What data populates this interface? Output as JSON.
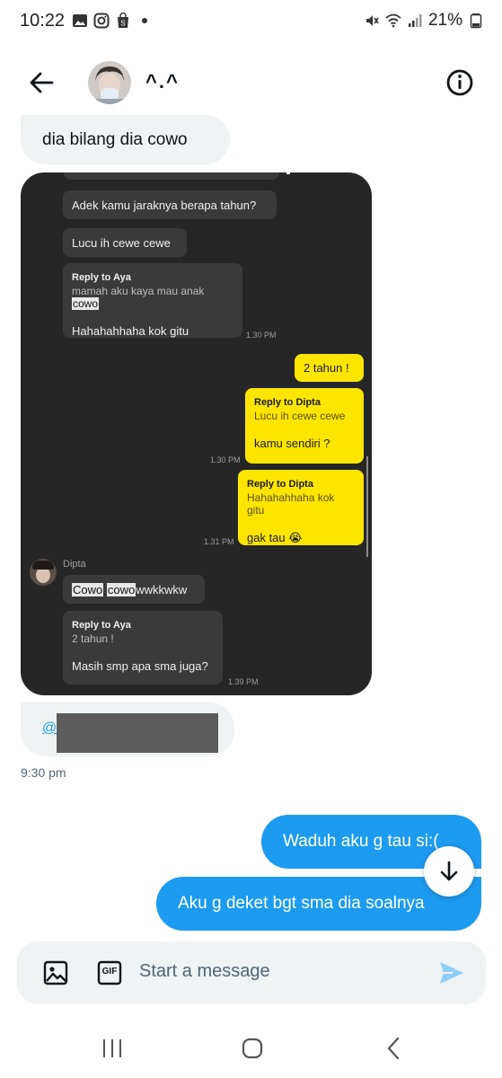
{
  "status_bar": {
    "time": "10:22",
    "battery": "21%",
    "left_icons": [
      "image-icon",
      "instagram-icon",
      "shop-icon",
      "dot-icon"
    ],
    "right_icons": [
      "mute-icon",
      "wifi-icon",
      "signal-icon",
      "battery-icon"
    ]
  },
  "header": {
    "title": "^.^",
    "back_icon": "arrow-left-icon",
    "info_icon": "info-icon"
  },
  "messages": {
    "in_1": "dia bilang dia cowo",
    "mention_prefix": "@",
    "timestamp_1": "9:30 pm",
    "out_1": "Waduh aku g tau si:(",
    "out_2": "Aku g deket bgt sma dia soalnya"
  },
  "screenshot": {
    "m1": "Adek kamu jaraknya berapa tahun?",
    "m2": "Lucu ih cewe cewe",
    "m3_reply_title": "Reply to Aya",
    "m3_quote_prefix": "mamah aku kaya mau anak ",
    "m3_quote_highlight": "cowo",
    "m3_text": "Hahahahhaha kok gitu",
    "m3_time": "1.30 PM",
    "o1": "2 tahun !",
    "o2_reply_title": "Reply to Dipta",
    "o2_quote": "Lucu ih cewe cewe",
    "o2_text": "kamu sendiri ?",
    "o2_time": "1.30 PM",
    "o3_reply_title": "Reply to Dipta",
    "o3_quote": "Hahahahhaha kok gitu",
    "o3_text": "gak tau 😭",
    "o3_time": "1.31 PM",
    "sender_name": "Dipta",
    "m4_hl1": "Cowo",
    "m4_hl2": "cowo",
    "m4_rest": " wwkkwkw",
    "m5_reply_title": "Reply to Aya",
    "m5_quote": "2 tahun !",
    "m5_text": "Masih smp apa sma juga?",
    "m5_time": "1.39 PM"
  },
  "composer": {
    "placeholder": "Start a message",
    "gif_label": "GIF",
    "icons": [
      "image-icon",
      "gif-icon",
      "send-icon"
    ]
  },
  "nav": {
    "icons": [
      "recent-apps-icon",
      "home-icon",
      "back-icon"
    ]
  },
  "colors": {
    "accent": "#1d9bf0",
    "bubble_in": "#eff3f4",
    "kakao_yellow": "#fee500",
    "screenshot_bg": "#262626"
  }
}
